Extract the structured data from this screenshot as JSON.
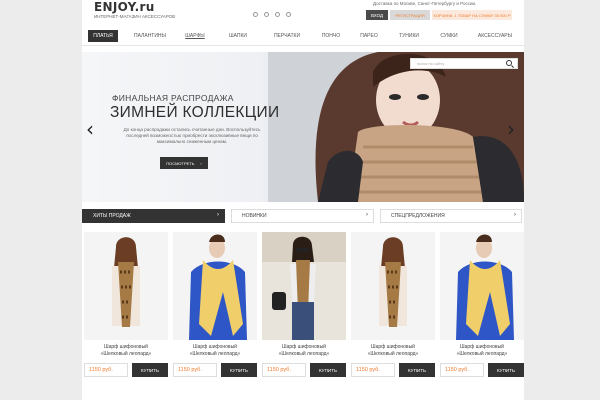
{
  "header": {
    "logo": "ENJOY.ru",
    "tagline": "ИНТЕРНЕТ-МАГАЗИН АКСЕССУАРОВ",
    "delivery_text": "Доставка по Москве, Санкт-Петербургу и России.",
    "login_label": "ВХОД",
    "register_label": "РЕГИСТРАЦИЯ",
    "cart_label": "КОРЗИНА: 1 ТОВАР НА СУММУ 35 000 Р",
    "social_icons": [
      "vk-icon",
      "mail-icon",
      "skype-icon",
      "phone-icon"
    ]
  },
  "nav": {
    "items": [
      "ПЛАТЬЯ",
      "ПАЛАНТИНЫ",
      "ШАРФЫ",
      "ШАПКИ",
      "ПЕРЧАТКИ",
      "ПОНЧО",
      "ПАРЕО",
      "ТУНИКИ",
      "СУМКИ",
      "АКСЕССУАРЫ"
    ]
  },
  "banner": {
    "search_placeholder": "поиск по сайту",
    "title_line1": "ФИНАЛЬНАЯ РАСПРОДАЖА",
    "title_line2": "ЗИМНЕЙ КОЛЛЕКЦИИ",
    "description": "До конца распродажи остались считанные дни. Воспользуйтесь последней возможностью приобрести эксклюзивные вещи по максимально сниженным ценам.",
    "button_label": "ПОСМОТРЕТЬ",
    "prev_arrow": "‹",
    "next_arrow": "›"
  },
  "tabs": [
    "ХИТЫ ПРОДАЖ",
    "НОВИНКИ",
    "СПЕЦПРЕДЛОЖЕНИЯ"
  ],
  "products": [
    {
      "name_line1": "Шарф шифоновый",
      "name_line2": "«Шелковый леопард»",
      "price": "1150 руб.",
      "buy_label": "КУПИТЬ"
    },
    {
      "name_line1": "Шарф шифоновый",
      "name_line2": "«Шелковый леопард»",
      "price": "1150 руб.",
      "buy_label": "КУПИТЬ"
    },
    {
      "name_line1": "Шарф шифоновый",
      "name_line2": "«Шелковый леопард»",
      "price": "1150 руб.",
      "buy_label": "КУПИТЬ"
    },
    {
      "name_line1": "Шарф шифоновый",
      "name_line2": "«Шелковый леопард»",
      "price": "1150 руб.",
      "buy_label": "КУПИТЬ"
    },
    {
      "name_line1": "Шарф шифоновый",
      "name_line2": "«Шелковый леопард»",
      "price": "1150 руб.",
      "buy_label": "КУПИТЬ"
    }
  ],
  "colors": {
    "accent": "#f17b2c",
    "dark": "#333333",
    "page_bg": "#ececec"
  }
}
